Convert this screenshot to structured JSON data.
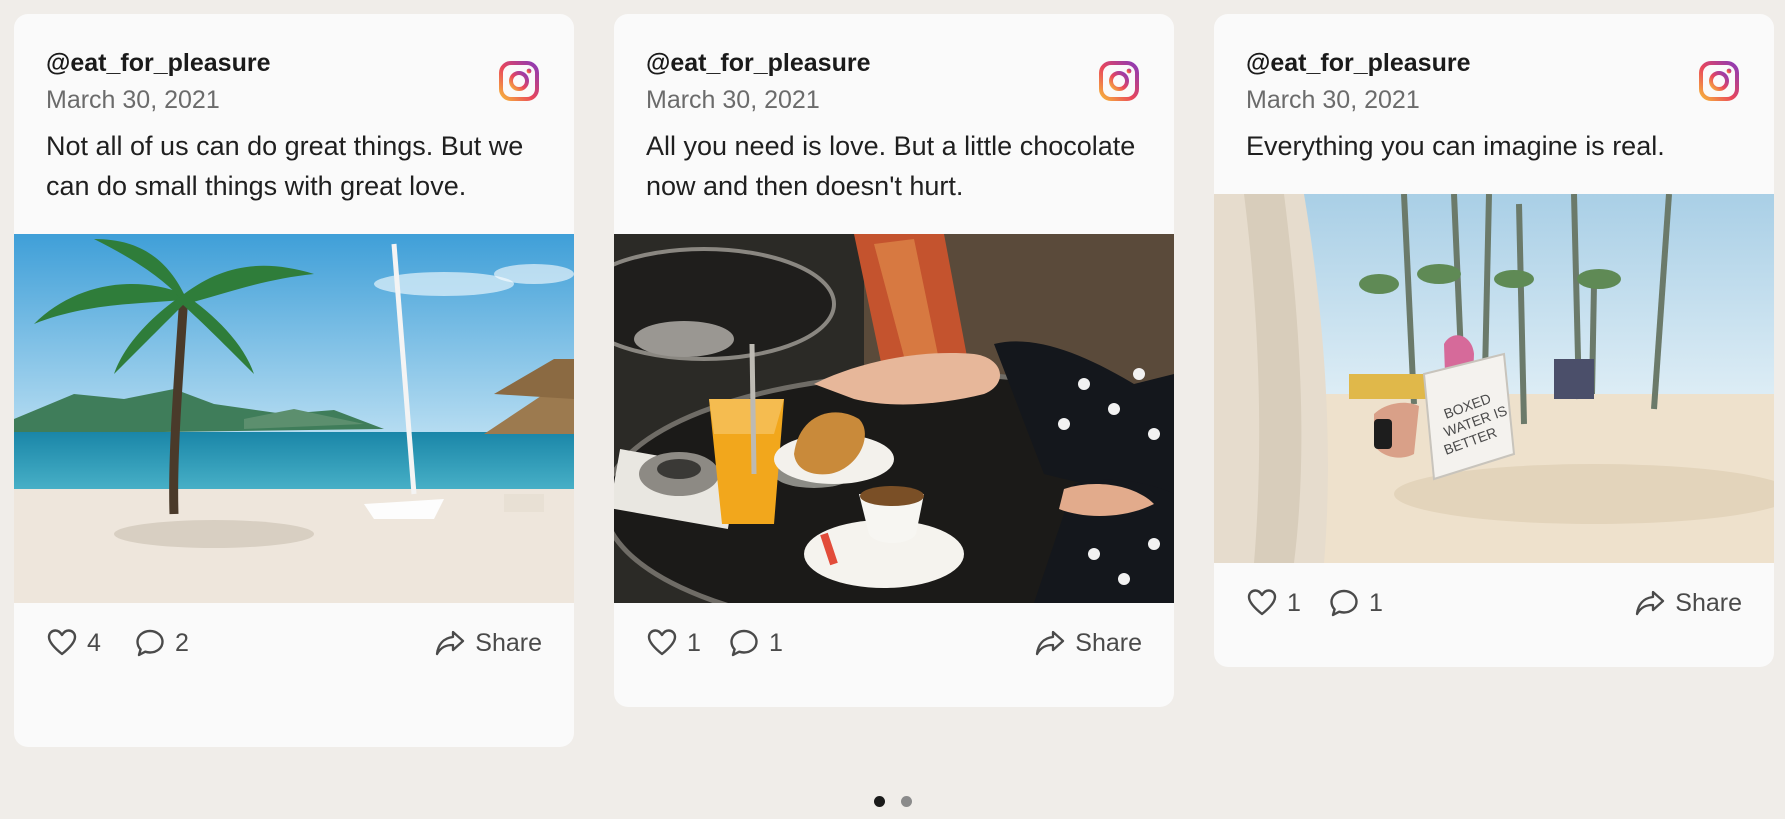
{
  "posts": [
    {
      "author": "@eat_for_pleasure",
      "date": "March 30, 2021",
      "caption": "Not all of us can do great things. But we can do small things with great love.",
      "image": "beach-palm-tree-photo",
      "likes": "4",
      "comments": "2",
      "share_label": "Share"
    },
    {
      "author": "@eat_for_pleasure",
      "date": "March 30, 2021",
      "caption": "All you need is love. But a little chocolate now and then doesn't hurt.",
      "image": "cafe-croissant-coffee-photo",
      "likes": "1",
      "comments": "1",
      "share_label": "Share"
    },
    {
      "author": "@eat_for_pleasure",
      "date": "March 30, 2021",
      "caption": "Everything you can imagine is real.",
      "image": "beach-boxed-water-photo",
      "likes": "1",
      "comments": "1",
      "share_label": "Share"
    }
  ],
  "pagination": {
    "pages": 2,
    "current": 1
  },
  "icons": {
    "source": "instagram-icon",
    "like": "heart-icon",
    "comment": "comment-bubble-icon",
    "share": "share-arrow-icon"
  },
  "colors": {
    "background": "#f0ede9",
    "card": "#fafafa",
    "text": "#1a1a1a",
    "muted": "#6b6b6b"
  }
}
